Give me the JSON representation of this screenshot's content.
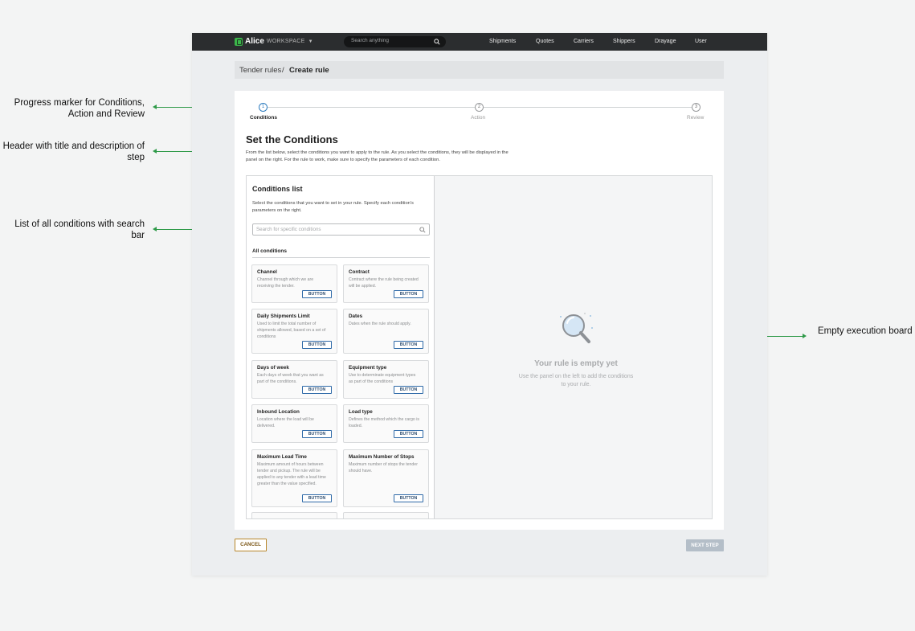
{
  "annotations": {
    "progress": "Progress marker for Conditions, Action and Review",
    "header": "Header with title and description of step",
    "list": "List of all conditions with search bar",
    "board": "Empty execution board"
  },
  "topbar": {
    "brand": "Alice",
    "workspace": "WORKSPACE",
    "search_placeholder": "Search anything",
    "nav": [
      "Shipments",
      "Quotes",
      "Carriers",
      "Shippers",
      "Drayage",
      "User"
    ]
  },
  "breadcrumb": {
    "parent": "Tender rules",
    "separator": "/",
    "current": "Create rule"
  },
  "stepper": {
    "steps": [
      {
        "number": "1",
        "label": "Conditions",
        "active": true
      },
      {
        "number": "2",
        "label": "Action",
        "active": false
      },
      {
        "number": "3",
        "label": "Review",
        "active": false
      }
    ]
  },
  "header": {
    "title": "Set the Conditions",
    "description": "From the list below, select the conditions you want to apply to the rule. As you select the conditions, they will be displayed in the panel on the right. For the rule to work, make sure to specify the parameters of each condition."
  },
  "conditions_panel": {
    "title": "Conditions list",
    "description": "Select the conditions that you want to set in your rule. Specify each condition's parameters on the right.",
    "search_placeholder": "Search for specific conditions",
    "section_label": "All conditions",
    "items": [
      {
        "title": "Channel",
        "desc": "Channel through which we are receiving the tender.",
        "button": "BUTTON"
      },
      {
        "title": "Contract",
        "desc": "Contract where the rule being created will be applied.",
        "button": "BUTTON"
      },
      {
        "title": "Daily Shipments Limit",
        "desc": "Used to limit the total number of shipments allowed, based on a set of conditions",
        "button": "BUTTON"
      },
      {
        "title": "Dates",
        "desc": "Dates when the rule should apply.",
        "button": "BUTTON"
      },
      {
        "title": "Days of week",
        "desc": "Each days of week that you want as part of the conditions.",
        "button": "BUTTON"
      },
      {
        "title": "Equipment type",
        "desc": "Use to determinate equipment types as part of the conditions",
        "button": "BUTTON"
      },
      {
        "title": "Inbound Location",
        "desc": "Location where the load will be delivered.",
        "button": "BUTTON"
      },
      {
        "title": "Load type",
        "desc": "Defines the method which the cargo is loaded.",
        "button": "BUTTON"
      },
      {
        "title": "Maximum Lead Time",
        "desc": "Maximum amount of hours between tender and pickup. The rule will be applied to any tender with a lead time greater than the value specified.",
        "button": "BUTTON"
      },
      {
        "title": "Maximum Number of Stops",
        "desc": "Maximum number of stops the tender should have.",
        "button": "BUTTON"
      }
    ]
  },
  "empty_board": {
    "title": "Your rule is empty yet",
    "description": "Use the panel on the left to add the conditions to your rule."
  },
  "footer": {
    "cancel": "CANCEL",
    "next": "NEXT STEP"
  },
  "colors": {
    "accent_green": "#3bb54a",
    "annotation_green": "#2e9a48",
    "step_active": "#2f7dbf",
    "topbar": "#2b2d2f",
    "cancel_border": "#b8862a",
    "next_disabled": "#b4bec8"
  },
  "icons": {
    "search": "magnifier-icon",
    "empty_state": "magnifying-glass-illustration",
    "brand": "alice-logo-icon",
    "dropdown": "caret-down-icon"
  }
}
